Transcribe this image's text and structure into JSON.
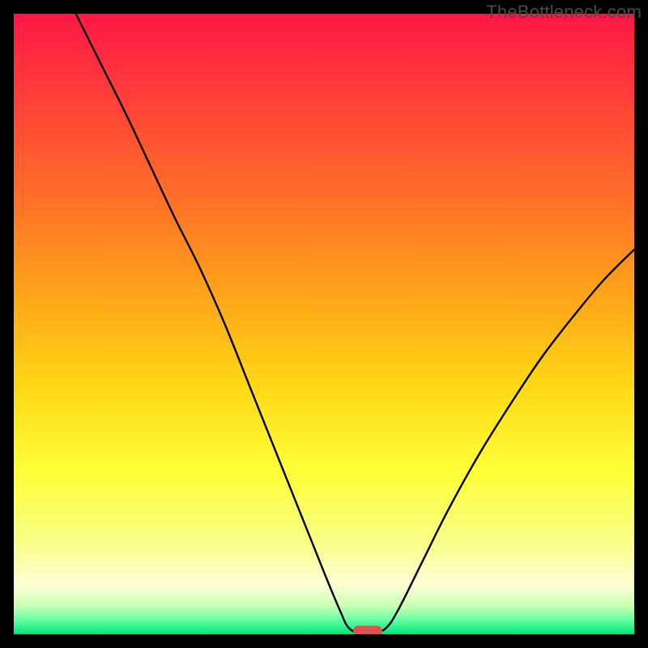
{
  "watermark": "TheBottleneck.com",
  "chart_data": {
    "type": "line",
    "title": "",
    "xlabel": "",
    "ylabel": "",
    "xlim": [
      0,
      100
    ],
    "ylim": [
      0,
      100
    ],
    "gradient_stops": [
      {
        "pos": 0.0,
        "color": "#ff1744"
      },
      {
        "pos": 0.12,
        "color": "#ff3b3b"
      },
      {
        "pos": 0.28,
        "color": "#ff6a2a"
      },
      {
        "pos": 0.45,
        "color": "#ffa31a"
      },
      {
        "pos": 0.6,
        "color": "#ffd815"
      },
      {
        "pos": 0.74,
        "color": "#ffff3a"
      },
      {
        "pos": 0.85,
        "color": "#f8ff85"
      },
      {
        "pos": 0.92,
        "color": "#ffffd6"
      },
      {
        "pos": 0.955,
        "color": "#c8ffb0"
      },
      {
        "pos": 0.975,
        "color": "#6fffa8"
      },
      {
        "pos": 1.0,
        "color": "#00e676"
      }
    ],
    "series": [
      {
        "name": "bottleneck-curve",
        "points": [
          {
            "x": 10.0,
            "y": 100.0
          },
          {
            "x": 14.0,
            "y": 92.0
          },
          {
            "x": 18.0,
            "y": 84.0
          },
          {
            "x": 22.0,
            "y": 75.5
          },
          {
            "x": 26.0,
            "y": 67.0
          },
          {
            "x": 30.0,
            "y": 59.0
          },
          {
            "x": 34.0,
            "y": 50.0
          },
          {
            "x": 38.0,
            "y": 40.0
          },
          {
            "x": 42.0,
            "y": 30.0
          },
          {
            "x": 46.0,
            "y": 20.0
          },
          {
            "x": 50.0,
            "y": 10.0
          },
          {
            "x": 52.5,
            "y": 4.0
          },
          {
            "x": 54.0,
            "y": 1.0
          },
          {
            "x": 56.0,
            "y": 0.2
          },
          {
            "x": 58.0,
            "y": 0.2
          },
          {
            "x": 60.0,
            "y": 1.0
          },
          {
            "x": 62.0,
            "y": 4.0
          },
          {
            "x": 66.0,
            "y": 12.0
          },
          {
            "x": 70.0,
            "y": 20.0
          },
          {
            "x": 75.0,
            "y": 29.0
          },
          {
            "x": 80.0,
            "y": 37.0
          },
          {
            "x": 85.0,
            "y": 44.5
          },
          {
            "x": 90.0,
            "y": 51.0
          },
          {
            "x": 95.0,
            "y": 57.0
          },
          {
            "x": 100.0,
            "y": 62.0
          }
        ]
      }
    ],
    "marker": {
      "x": 57.0,
      "y": 0.5,
      "color": "#d9534f"
    }
  }
}
